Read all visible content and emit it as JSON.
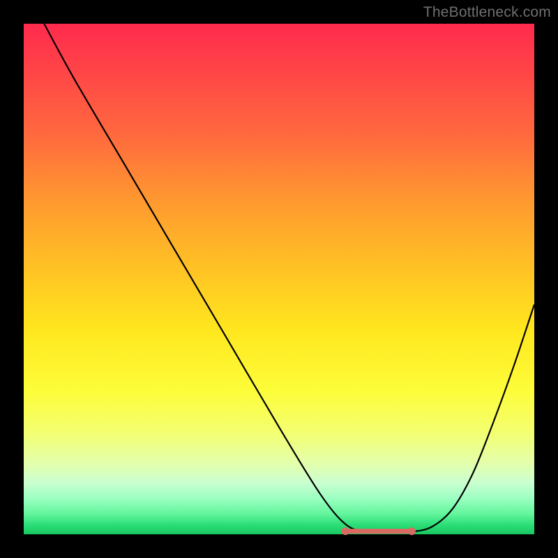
{
  "watermark": "TheBottleneck.com",
  "colors": {
    "page_bg": "#000000",
    "curve_stroke": "#000000",
    "marker_stroke": "#d96a62",
    "marker_fill": "#d96a62"
  },
  "chart_data": {
    "type": "line",
    "title": "",
    "xlabel": "",
    "ylabel": "",
    "xlim": [
      0,
      100
    ],
    "ylim": [
      0,
      100
    ],
    "grid": false,
    "legend": null,
    "series": [
      {
        "name": "bottleneck-curve",
        "x": [
          4,
          10,
          20,
          30,
          40,
          50,
          58,
          63,
          67,
          72,
          76,
          80,
          84,
          88,
          92,
          96,
          100
        ],
        "y": [
          100,
          89,
          72,
          55,
          38,
          21,
          8,
          2,
          0.5,
          0.3,
          0.5,
          1.5,
          5,
          12,
          22,
          33,
          45
        ]
      }
    ],
    "annotations": [
      {
        "name": "flat-bottom-marker",
        "type": "segment",
        "x": [
          63,
          76
        ],
        "y": [
          0.6,
          0.6
        ],
        "endpoints": true
      }
    ]
  }
}
